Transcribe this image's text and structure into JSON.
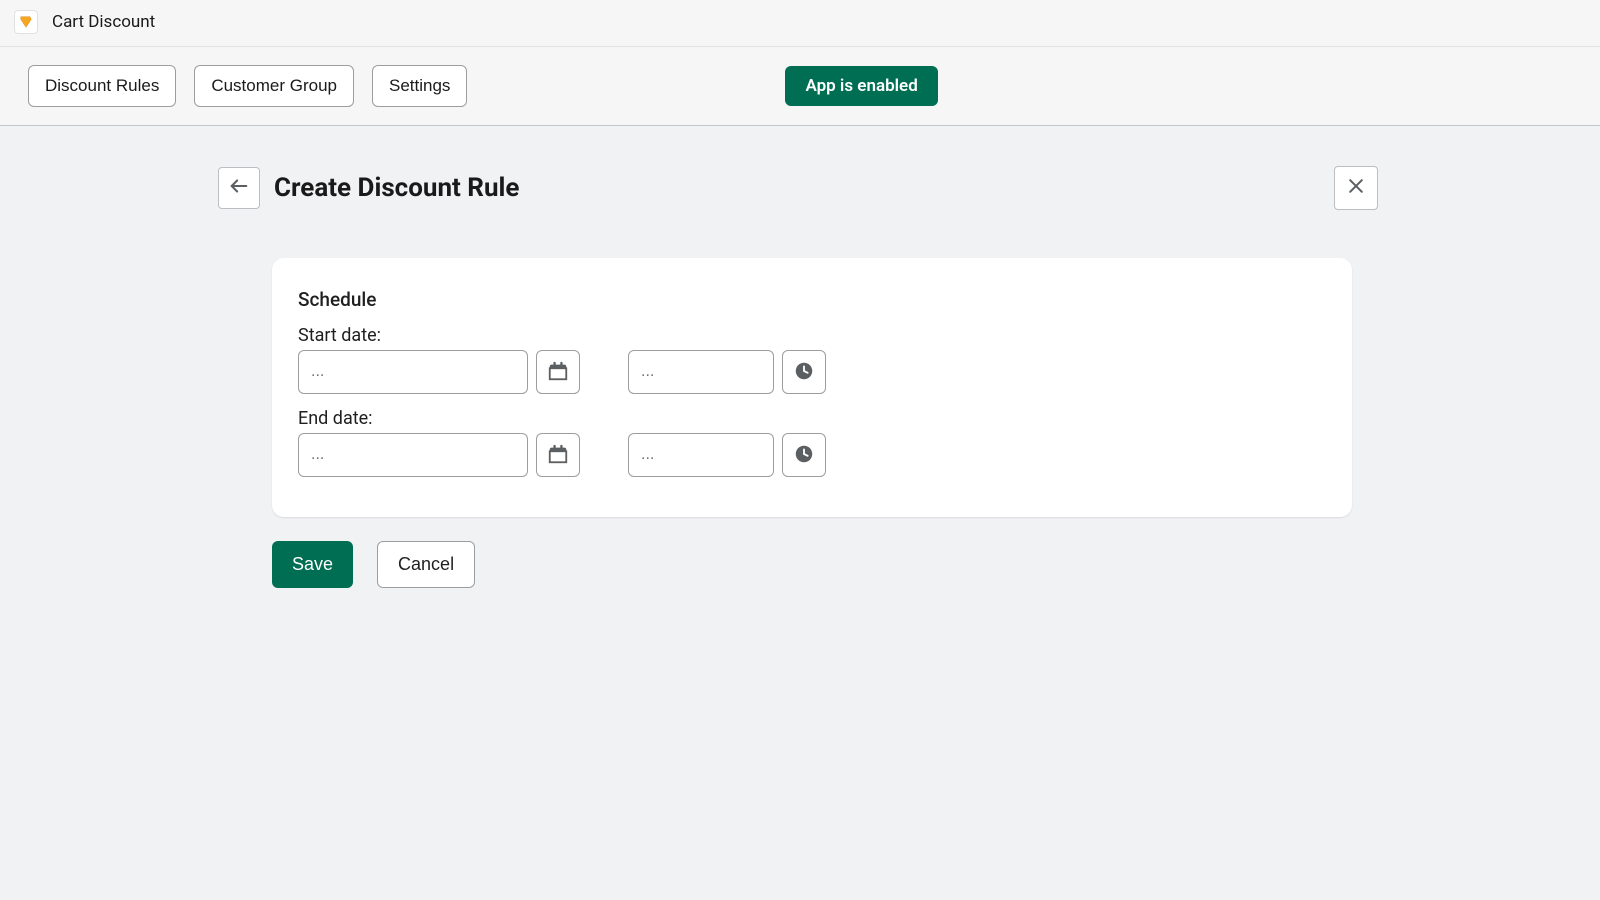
{
  "titlebar": {
    "app_name": "Cart Discount"
  },
  "nav": {
    "discount_rules": "Discount Rules",
    "customer_group": "Customer Group",
    "settings": "Settings",
    "status_label": "App is enabled"
  },
  "page": {
    "title": "Create Discount Rule"
  },
  "schedule": {
    "section_title": "Schedule",
    "start_label": "Start date:",
    "start_date_placeholder": "...",
    "start_time_placeholder": "...",
    "end_label": "End date:",
    "end_date_placeholder": "...",
    "end_time_placeholder": "..."
  },
  "actions": {
    "save": "Save",
    "cancel": "Cancel"
  },
  "colors": {
    "brand_green": "#006e52",
    "border_gray": "#9b9ea1",
    "bg_gray": "#f1f2f4"
  }
}
